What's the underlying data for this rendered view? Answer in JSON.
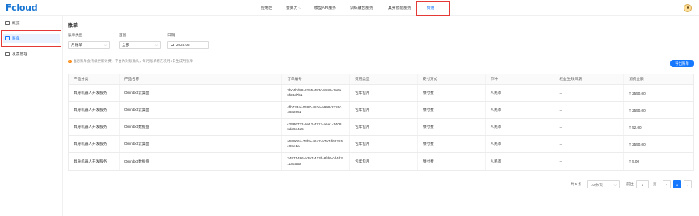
{
  "header": {
    "logo": "Fcloud",
    "nav": [
      "控制台",
      "会算力",
      "模型API服务",
      "训练融合服务",
      "具身智能服务",
      "费用"
    ],
    "nav_dropdown_index": 1,
    "active_nav_index": 5
  },
  "sidebar": {
    "items": [
      {
        "label": "概览"
      },
      {
        "label": "账单"
      },
      {
        "label": "发票管理"
      }
    ],
    "active_index": 1
  },
  "main": {
    "title": "账单",
    "filters": {
      "bill_type": {
        "label": "账单类型",
        "value": "月账单"
      },
      "scope": {
        "label": "范围",
        "value": "全部"
      },
      "date": {
        "label": "日期",
        "value": "2025.06"
      }
    },
    "notice": "当月账单会持续更新计费，平台为对账确认，每月账单将在次月1日生成月账单",
    "export_label": "导出账单"
  },
  "table": {
    "columns": [
      "产品分类",
      "产品名称",
      "订单编号",
      "费用类型",
      "支付方式",
      "币种",
      "权益生效日期",
      "消费金额"
    ],
    "rows": [
      [
        "具身机器人开发服务",
        "Omnibot云桌面",
        "3bc4bd88-8255-483c-8580-1e6a6f23d7b1",
        "包年包月",
        "预付费",
        "人民币",
        "--",
        "¥ 2550.00"
      ],
      [
        "具身机器人开发服务",
        "Omnibot云桌面",
        "4fb733af-0487-482e-a999-2326c4682652",
        "包年包月",
        "预付费",
        "人民币",
        "--",
        "¥ 2550.00"
      ],
      [
        "具身机器人开发服务",
        "Omnibot数据盘",
        "c2586732-8e12-4713-a5e1-14086dd9a4d5",
        "包年包月",
        "预付费",
        "人民币",
        "--",
        "¥ 52.00"
      ],
      [
        "具身机器人开发服务",
        "Omnibot云桌面",
        "a599064-73ba-4647-a7a7-f62215e98e1a",
        "包年包月",
        "预付费",
        "人民币",
        "--",
        "¥ 2550.00"
      ],
      [
        "具身机器人开发服务",
        "Omnibot数据盘",
        "24971486-a3e7-413b-8fd6-cd4d3118c55a",
        "包年包月",
        "预付费",
        "人民币",
        "--",
        "¥ 5.00"
      ]
    ]
  },
  "pagination": {
    "total": "共 5 条",
    "page_size": "10条/页",
    "goto_label": "前往",
    "goto_value": "1",
    "page_suffix": "页",
    "prev": "<",
    "current": "1",
    "next": ">"
  },
  "colors": {
    "accent": "#1677ff",
    "highlight": "#e53935",
    "warning": "#fa8c16"
  }
}
